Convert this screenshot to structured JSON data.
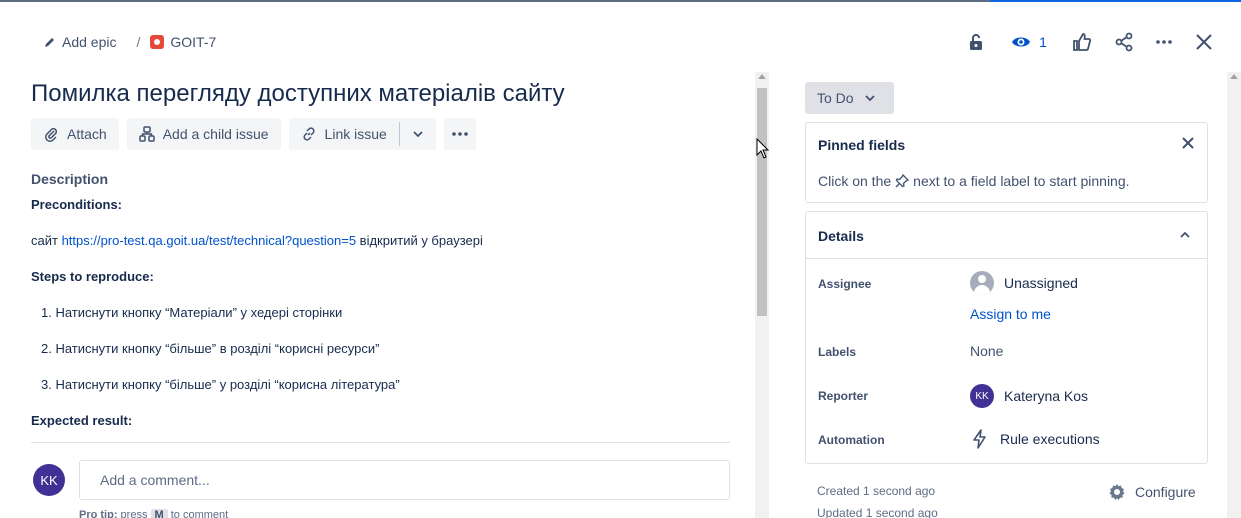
{
  "breadcrumb": {
    "epic_label": "Add epic",
    "separator": "/",
    "issue_key": "GOIT-7"
  },
  "header": {
    "watch_count": "1",
    "icons": [
      "unlock-icon",
      "eye-icon",
      "thumbs-up-icon",
      "share-icon",
      "more-icon",
      "close-icon"
    ]
  },
  "issue": {
    "title": "Помилка перегляду доступних матеріалів сайту"
  },
  "toolbar": {
    "attach": "Attach",
    "add_child": "Add a child issue",
    "link_issue": "Link issue"
  },
  "description": {
    "label": "Description",
    "preconditions_heading": "Preconditions:",
    "precondition_prefix": "сайт ",
    "precondition_link": "https://pro-test.qa.goit.ua/test/technical?question=5",
    "precondition_suffix": " відкритий у браузері",
    "steps_heading": "Steps to reproduce:",
    "steps": [
      "1. Натиснути кнопку “Матеріали” у хедері сторінки",
      "2. Натиснути кнопку “більше” в розділі “корисні ресурси”",
      "3. Натиснути кнопку “більше” у розділі “корисна література”"
    ],
    "expected_heading": "Expected result:"
  },
  "comment": {
    "avatar_initials": "KK",
    "placeholder": "Add a comment...",
    "protip_prefix": "Pro tip:",
    "protip_press": " press ",
    "protip_key": "M",
    "protip_suffix": " to comment"
  },
  "status": {
    "label": "To Do"
  },
  "pinned": {
    "title": "Pinned fields",
    "text_before": "Click on the",
    "text_after": "next to a field label to start pinning."
  },
  "details": {
    "title": "Details",
    "assignee_label": "Assignee",
    "assignee_value": "Unassigned",
    "assign_to_me": "Assign to me",
    "labels_label": "Labels",
    "labels_value": "None",
    "reporter_label": "Reporter",
    "reporter_initials": "KK",
    "reporter_value": "Kateryna Kos",
    "automation_label": "Automation",
    "automation_value": "Rule executions"
  },
  "meta": {
    "created": "Created 1 second ago",
    "updated": "Updated 1 second ago",
    "configure": "Configure"
  },
  "colors": {
    "link": "#0052cc",
    "avatar": "#403294",
    "bug": "#e5493a"
  }
}
